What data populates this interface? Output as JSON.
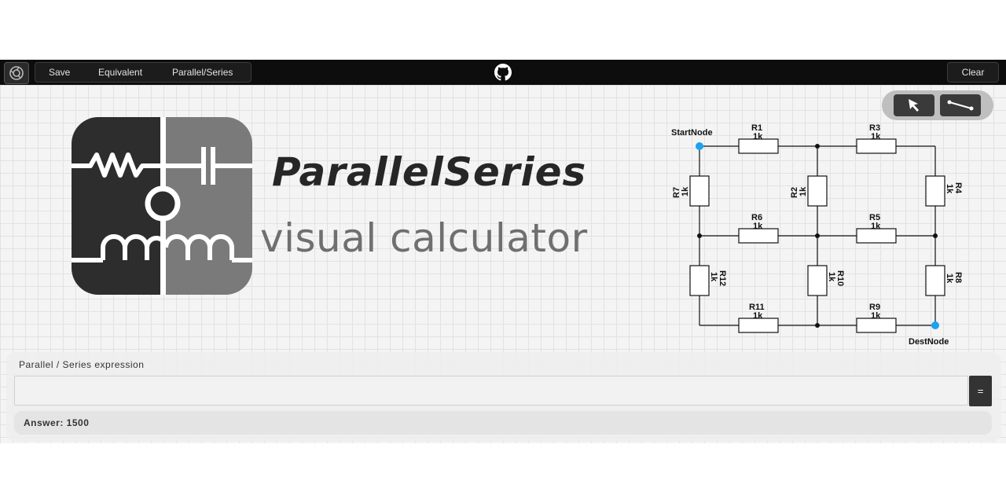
{
  "toolbar": {
    "save_label": "Save",
    "equivalent_label": "Equivalent",
    "parallel_series_label": "Parallel/Series",
    "clear_label": "Clear",
    "icons": [
      "settings-icon",
      "github-icon"
    ]
  },
  "branding": {
    "title": "ParallelSeries",
    "subtitle": "visual calculator"
  },
  "tools": {
    "items": [
      "select-arrow-icon",
      "wire-icon"
    ]
  },
  "circuit": {
    "start_label": "StartNode",
    "dest_label": "DestNode",
    "node_color": "#1da1f2",
    "resistors": [
      {
        "name": "R1",
        "value": "1k"
      },
      {
        "name": "R3",
        "value": "1k"
      },
      {
        "name": "R7",
        "value": "1k"
      },
      {
        "name": "R2",
        "value": "1k"
      },
      {
        "name": "R4",
        "value": "1k"
      },
      {
        "name": "R6",
        "value": "1k"
      },
      {
        "name": "R5",
        "value": "1k"
      },
      {
        "name": "R12",
        "value": "1k"
      },
      {
        "name": "R10",
        "value": "1k"
      },
      {
        "name": "R8",
        "value": "1k"
      },
      {
        "name": "R11",
        "value": "1k"
      },
      {
        "name": "R9",
        "value": "1k"
      }
    ]
  },
  "expression": {
    "label": "Parallel / Series expression",
    "value": "",
    "calc_label": "="
  },
  "result": {
    "answer": "Answer: 1500"
  }
}
